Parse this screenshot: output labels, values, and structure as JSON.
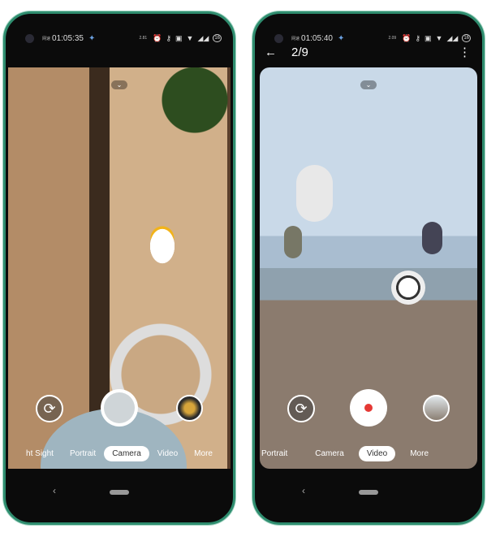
{
  "phones": [
    {
      "status": {
        "carrier": "网速",
        "time": "01:05:35",
        "speed": "2.81",
        "speed_unit": "KB/S",
        "battery": "16"
      },
      "modes": [
        "ht Sight",
        "Portrait",
        "Camera",
        "Video",
        "More"
      ],
      "selected_mode": "Camera",
      "shutter": "photo"
    },
    {
      "status": {
        "carrier": "网速",
        "time": "01:05:40",
        "speed": "2.09",
        "speed_unit": "KB/S",
        "battery": "16"
      },
      "topbar": {
        "back": "←",
        "pager": "2/9",
        "menu": "⋮"
      },
      "modes": [
        "Portrait",
        "Camera",
        "Video",
        "More"
      ],
      "selected_mode": "Video",
      "shutter": "video"
    }
  ],
  "icons": {
    "chevron": "⌄",
    "switch": "⟳",
    "nav_back": "‹"
  },
  "colors": {
    "frame": "#2f8d6f",
    "record": "#e53935"
  }
}
